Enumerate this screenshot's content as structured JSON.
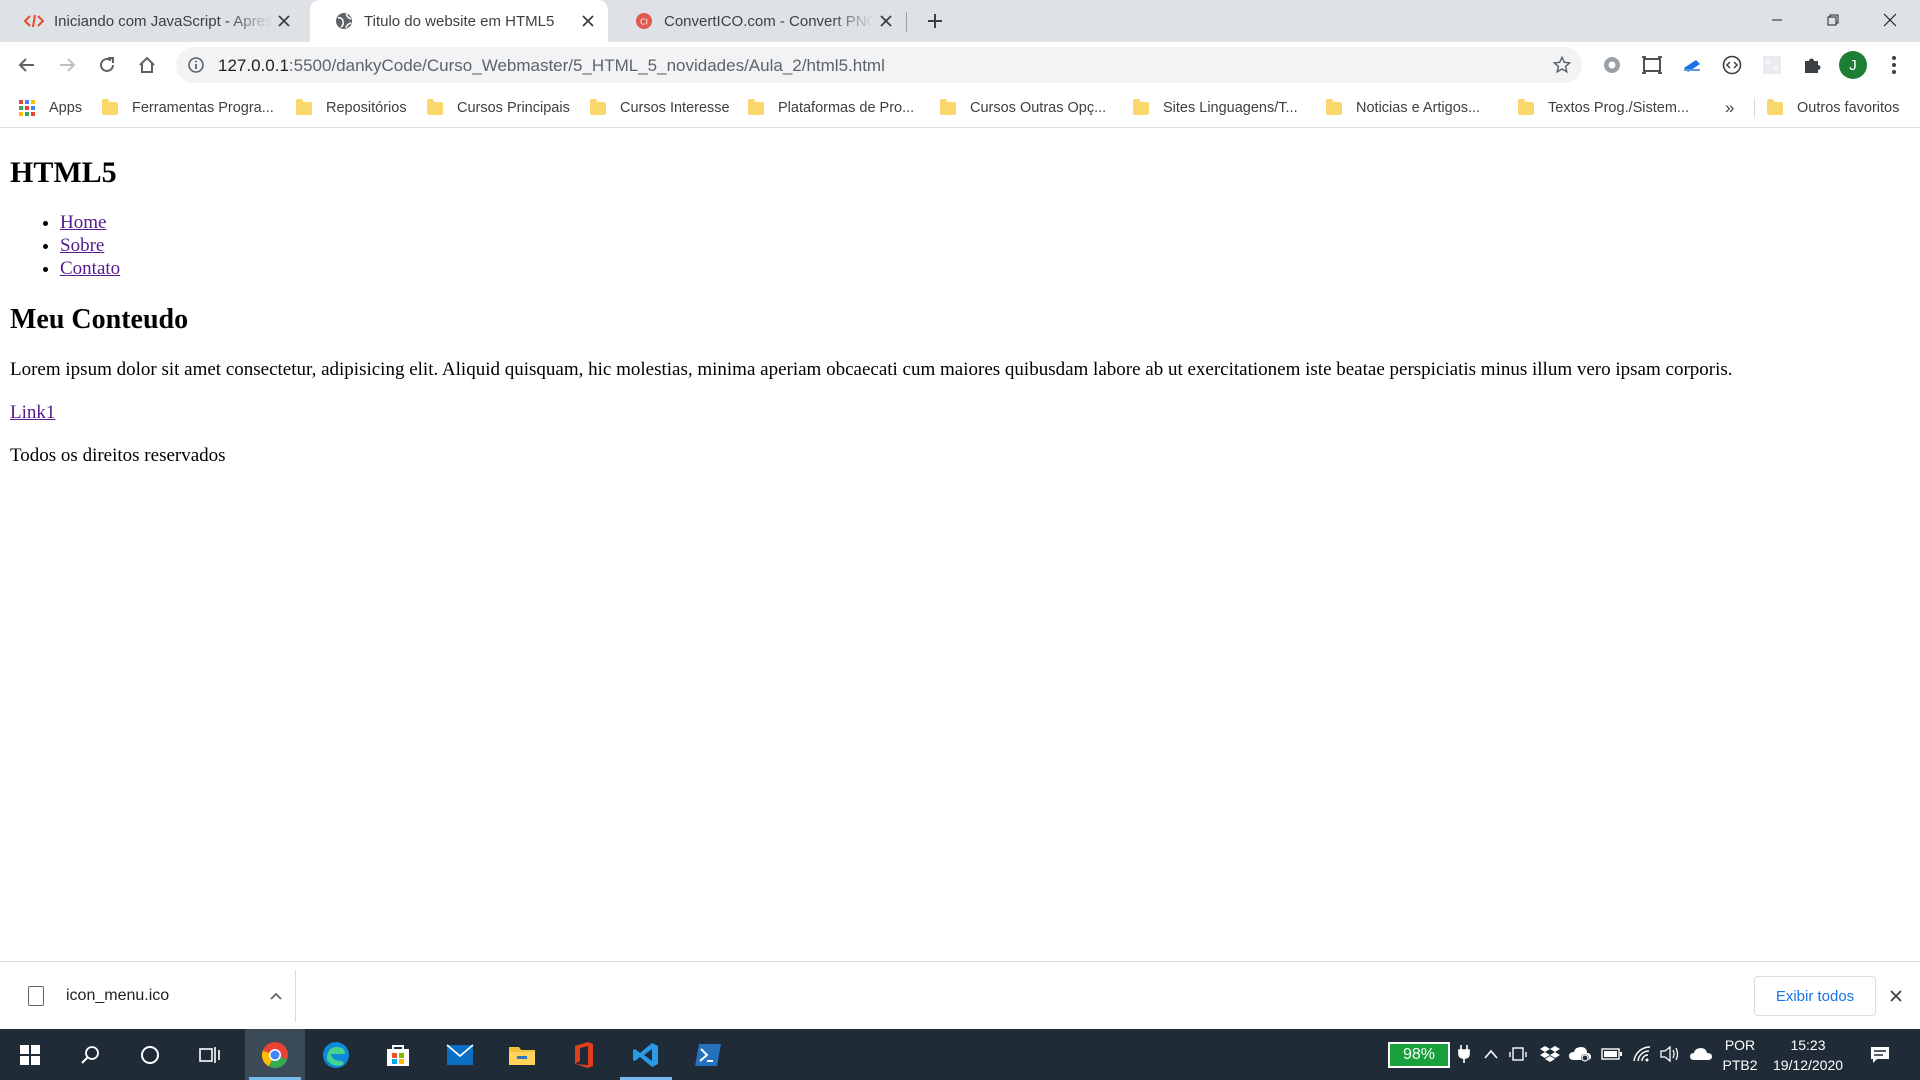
{
  "browser": {
    "tabs": [
      {
        "title": "Iniciando com JavaScript - Apres",
        "icon": "code-icon",
        "active": false
      },
      {
        "title": "Titulo do website em HTML5",
        "icon": "globe-icon",
        "active": true
      },
      {
        "title": "ConvertICO.com - Convert PNG t",
        "icon": "converticon-icon",
        "active": false
      }
    ],
    "url": {
      "host": "127.0.0.1",
      "rest": ":5500/dankyCode/Curso_Webmaster/5_HTML_5_novidades/Aula_2/html5.html"
    },
    "avatar_letter": "J",
    "bookmarks": {
      "apps_label": "Apps",
      "items": [
        "Ferramentas Progra...",
        "Repositórios",
        "Cursos Principais",
        "Cursos Interesse",
        "Plataformas de Pro...",
        "Cursos Outras Opç...",
        "Sites Linguagens/T...",
        "Noticias e Artigos...",
        "Textos Prog./Sistem..."
      ],
      "overflow": "»",
      "other_favorites": "Outros favoritos"
    }
  },
  "page": {
    "heading": "HTML5",
    "nav": [
      "Home",
      "Sobre",
      "Contato"
    ],
    "content_title": "Meu Conteudo",
    "paragraph": "Lorem ipsum dolor sit amet consectetur, adipisicing elit. Aliquid quisquam, hic molestias, minima aperiam obcaecati cum maiores quibusdam labore ab ut exercitationem iste beatae perspiciatis minus illum vero ipsam corporis.",
    "link": "Link1",
    "footer": "Todos os direitos reservados"
  },
  "download_shelf": {
    "file_name": "icon_menu.ico",
    "show_all_label": "Exibir todos"
  },
  "taskbar": {
    "battery": "98%",
    "lang_top": "POR",
    "lang_bottom": "PTB2",
    "time": "15:23",
    "date": "19/12/2020"
  },
  "colors": {
    "accent": "#1a73e8",
    "visited_link": "#551a8b",
    "taskbar_bg": "#1f2b36",
    "battery_green": "#18a03c"
  }
}
